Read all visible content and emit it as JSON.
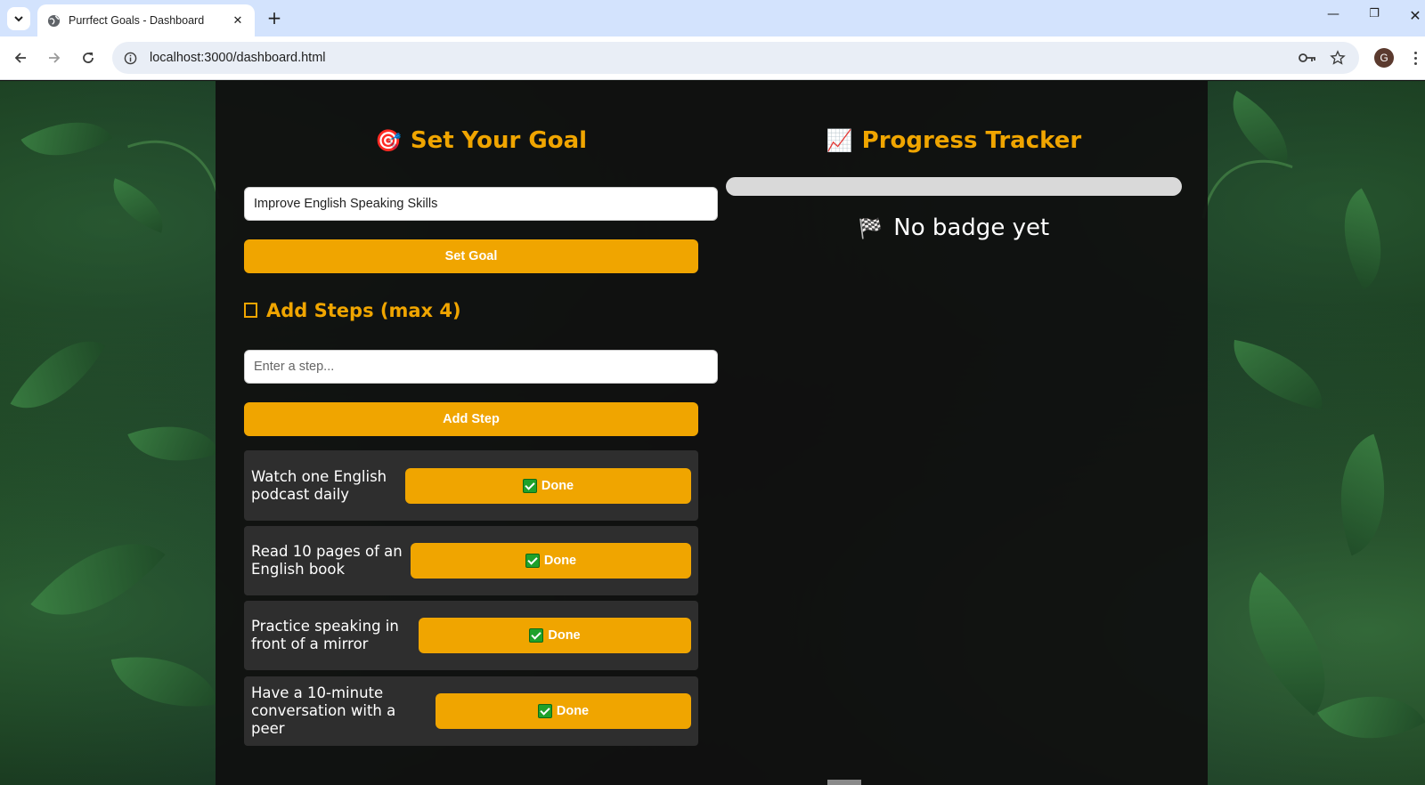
{
  "browser": {
    "tab_title": "Purrfect Goals - Dashboard",
    "tab_close": "✕",
    "new_tab": "+",
    "url": "localhost:3000/dashboard.html",
    "profile_initial": "G",
    "icons": [
      "tab-list-icon",
      "globe-icon",
      "back-icon",
      "forward-icon",
      "reload-icon",
      "info-icon",
      "password-key-icon",
      "star-icon",
      "menu-icon"
    ]
  },
  "goal": {
    "title_emoji": "🎯",
    "title": "Set Your Goal",
    "input_value": "Improve English Speaking Skills",
    "set_goal_label": "Set Goal"
  },
  "steps": {
    "title": "Add Steps (max 4)",
    "input_placeholder": "Enter a step...",
    "add_step_label": "Add Step",
    "items": [
      {
        "text": "Watch one English podcast daily",
        "done_label": "Done"
      },
      {
        "text": "Read 10 pages of an English book",
        "done_label": "Done"
      },
      {
        "text": "Practice speaking in front of a mirror",
        "done_label": "Done"
      },
      {
        "text": "Have a 10-minute conversation with a peer",
        "done_label": "Done"
      }
    ]
  },
  "progress": {
    "title_emoji": "📈",
    "title": "Progress Tracker",
    "percent": 0,
    "badge_emoji": "🏁",
    "badge_text": "No badge yet"
  },
  "colors": {
    "accent": "#f0a500",
    "panel": "#101010",
    "card": "#2e2e2e",
    "progress_track": "#d9d9d9"
  }
}
